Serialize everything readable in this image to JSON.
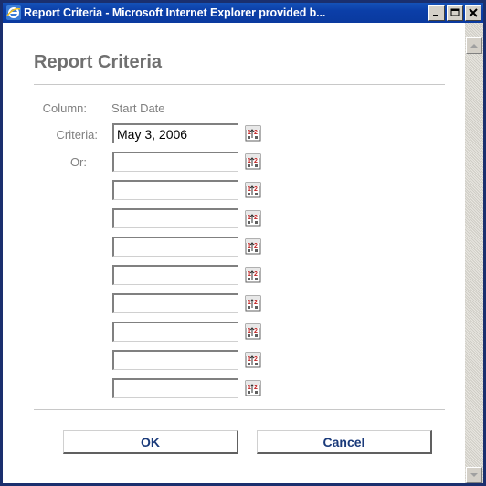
{
  "window": {
    "title": "Report Criteria - Microsoft Internet Explorer provided b...",
    "controls": {
      "minimize": "_",
      "maximize": "□",
      "close": "X"
    }
  },
  "dialog": {
    "heading": "Report Criteria",
    "column_label": "Column:",
    "column_value": "Start Date",
    "criteria_label": "Criteria:",
    "or_label": "Or:",
    "fields": [
      {
        "value": "May 3, 2006"
      },
      {
        "value": ""
      },
      {
        "value": ""
      },
      {
        "value": ""
      },
      {
        "value": ""
      },
      {
        "value": ""
      },
      {
        "value": ""
      },
      {
        "value": ""
      },
      {
        "value": ""
      },
      {
        "value": ""
      }
    ],
    "picker_icon": "date-picker-icon",
    "ok_label": "OK",
    "cancel_label": "Cancel"
  },
  "colors": {
    "titlebar": "#0a3a9f",
    "label_gray": "#808080",
    "button_text": "#1a3a7a"
  }
}
